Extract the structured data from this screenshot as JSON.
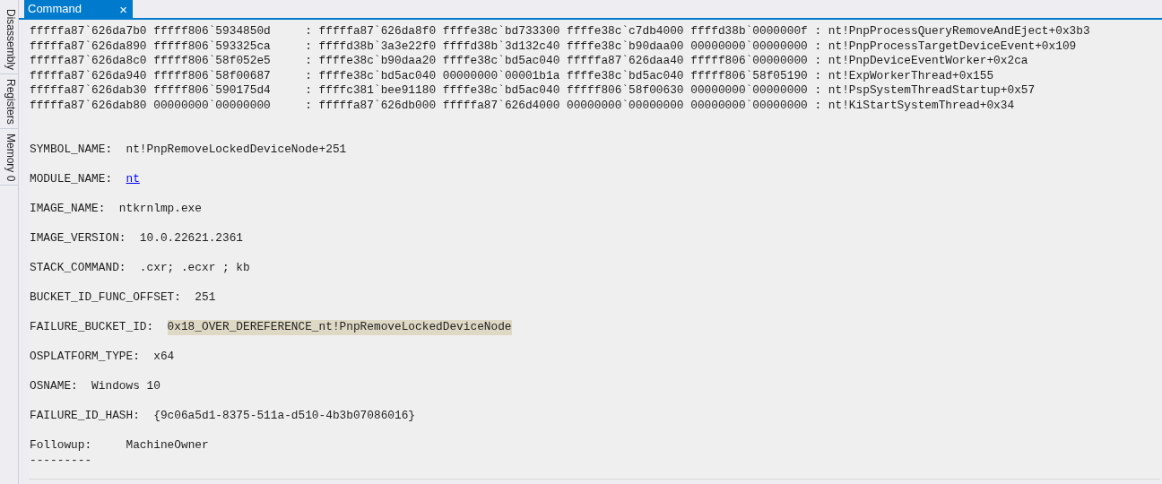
{
  "side_tabs": [
    {
      "label": "Disassembly",
      "selected": false
    },
    {
      "label": "Registers",
      "selected": false
    },
    {
      "label": "Memory 0",
      "selected": false
    }
  ],
  "document_tabs": [
    {
      "label": "Command",
      "selected": true,
      "close": "×"
    }
  ],
  "stack_frames": [
    "fffffa87`626da7b0 fffff806`5934850d     : fffffa87`626da8f0 ffffe38c`bd733300 ffffe38c`c7db4000 ffffd38b`0000000f : nt!PnpProcessQueryRemoveAndEject+0x3b3",
    "fffffa87`626da890 fffff806`593325ca     : ffffd38b`3a3e22f0 ffffd38b`3d132c40 ffffe38c`b90daa00 00000000`00000000 : nt!PnpProcessTargetDeviceEvent+0x109",
    "fffffa87`626da8c0 fffff806`58f052e5     : ffffe38c`b90daa20 ffffe38c`bd5ac040 fffffa87`626daa40 fffff806`00000000 : nt!PnpDeviceEventWorker+0x2ca",
    "fffffa87`626da940 fffff806`58f00687     : ffffe38c`bd5ac040 00000000`00001b1a ffffe38c`bd5ac040 fffff806`58f05190 : nt!ExpWorkerThread+0x155",
    "fffffa87`626dab30 fffff806`590175d4     : ffffc381`bee91180 ffffe38c`bd5ac040 fffff806`58f00630 00000000`00000000 : nt!PspSystemThreadStartup+0x57",
    "fffffa87`626dab80 00000000`00000000     : fffffa87`626db000 fffffa87`626d4000 00000000`00000000 00000000`00000000 : nt!KiStartSystemThread+0x34"
  ],
  "fields": [
    {
      "kind": "plain",
      "label": "SYMBOL_NAME:",
      "value": "nt!PnpRemoveLockedDeviceNode+251"
    },
    {
      "kind": "link",
      "label": "MODULE_NAME:",
      "value": "nt"
    },
    {
      "kind": "plain",
      "label": "IMAGE_NAME:",
      "value": "ntkrnlmp.exe"
    },
    {
      "kind": "plain",
      "label": "IMAGE_VERSION:",
      "value": "10.0.22621.2361"
    },
    {
      "kind": "plain",
      "label": "STACK_COMMAND:",
      "value": ".cxr; .ecxr ; kb"
    },
    {
      "kind": "plain",
      "label": "BUCKET_ID_FUNC_OFFSET:",
      "value": "251"
    },
    {
      "kind": "highlight",
      "label": "FAILURE_BUCKET_ID:",
      "value": "0x18_OVER_DEREFERENCE_nt!PnpRemoveLockedDeviceNode"
    },
    {
      "kind": "plain",
      "label": "OSPLATFORM_TYPE:",
      "value": "x64"
    },
    {
      "kind": "plain",
      "label": "OSNAME:",
      "value": "Windows 10"
    },
    {
      "kind": "plain",
      "label": "FAILURE_ID_HASH:",
      "value": "{9c06a5d1-8375-511a-d510-4b3b07086016}"
    },
    {
      "kind": "tabbed",
      "label": "Followup:",
      "value": "MachineOwner"
    }
  ],
  "separator": "---------"
}
